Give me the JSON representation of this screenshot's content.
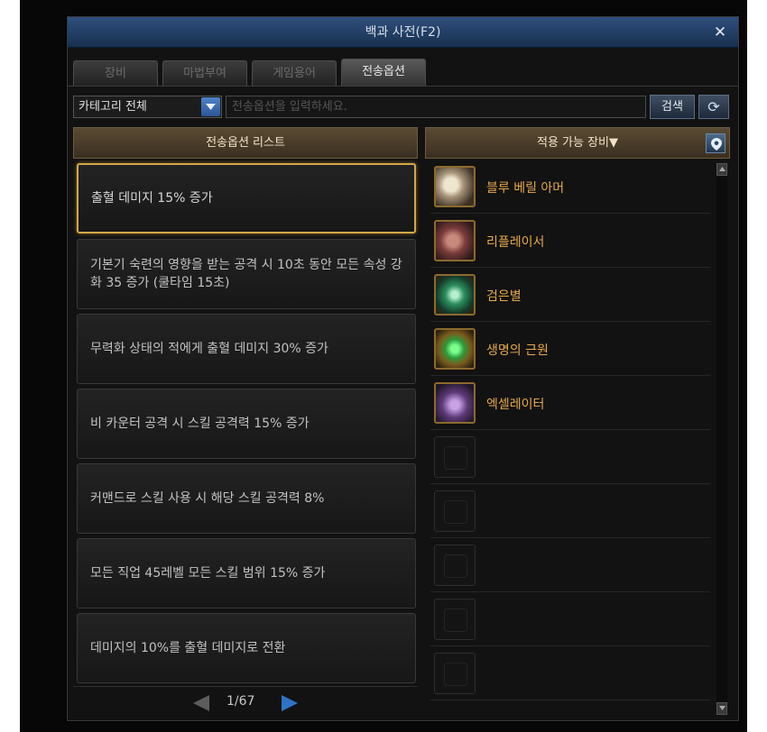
{
  "window": {
    "title": "백과 사전(F2)"
  },
  "tabs": [
    {
      "label": "장비"
    },
    {
      "label": "마법부여"
    },
    {
      "label": "게임용어"
    },
    {
      "label": "전송옵션"
    }
  ],
  "filter": {
    "category": "카테고리 전체",
    "search_placeholder": "전송옵션을 입력하세요.",
    "search_button": "검색"
  },
  "options_panel": {
    "header": "전송옵션 리스트",
    "items": [
      {
        "text": "출혈 데미지 15% 증가",
        "selected": true
      },
      {
        "text": "기본기 숙련의 영향을 받는 공격 시 10초 동안 모든 속성 강화 35 증가 (쿨타임 15초)"
      },
      {
        "text": "무력화 상태의 적에게 출혈 데미지 30% 증가"
      },
      {
        "text": "비 카운터 공격 시 스킬 공격력 15% 증가"
      },
      {
        "text": "커맨드로 스킬 사용 시 해당 스킬 공격력 8%"
      },
      {
        "text": "모든 직업 45레벨 모든 스킬 범위 15% 증가"
      },
      {
        "text": "데미지의 10%를 출혈 데미지로 전환"
      }
    ],
    "pagination": {
      "page": "1/67"
    }
  },
  "equipment_panel": {
    "header": "적용 가능 장비▼",
    "items": [
      {
        "name": "블루 베릴 아머",
        "icon": "blue-beryl-armor-icon"
      },
      {
        "name": "리플레이서",
        "icon": "replacer-icon"
      },
      {
        "name": "검은별",
        "icon": "black-star-icon"
      },
      {
        "name": "생명의 근원",
        "icon": "source-of-life-icon"
      },
      {
        "name": "엑셀레이터",
        "icon": "accelerator-icon"
      }
    ],
    "empty_slots": 5
  },
  "colors": {
    "accent_gold": "#d4a64a",
    "item_name": "#e6a94a",
    "title_bar": "#2f4f7e",
    "next_arrow": "#2e73c4"
  }
}
